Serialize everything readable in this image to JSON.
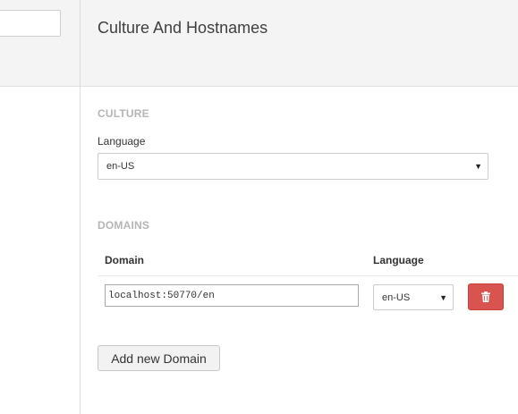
{
  "left_panel": {
    "search_value": ""
  },
  "dialog": {
    "title": "Culture And Hostnames"
  },
  "culture": {
    "section_title": "CULTURE",
    "language_label": "Language",
    "language_value": "en-US"
  },
  "domains": {
    "section_title": "DOMAINS",
    "columns": [
      "Domain",
      "Language"
    ],
    "rows": [
      {
        "domain": "localhost:50770/en",
        "language": "en-US"
      }
    ],
    "add_button_label": "Add new Domain"
  },
  "icons": {
    "delete": "trash-icon",
    "dropdown": "caret-down-icon"
  },
  "colors": {
    "delete_button": "#d9534f",
    "section_title": "#b5b5b5",
    "header_bg": "#f4f4f4"
  }
}
